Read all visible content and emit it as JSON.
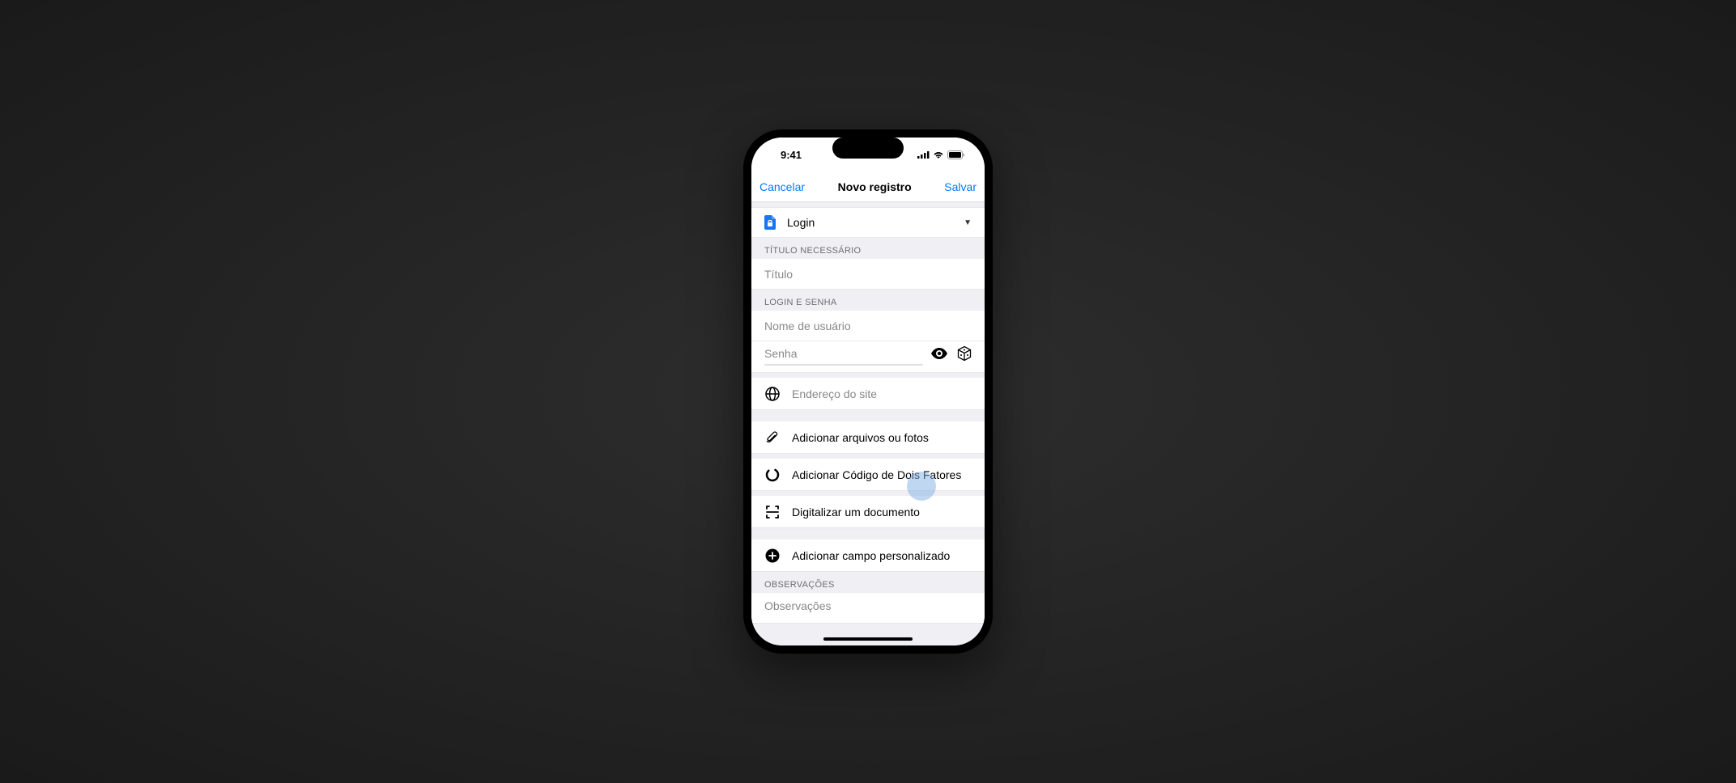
{
  "status_bar": {
    "time": "9:41"
  },
  "nav": {
    "cancel": "Cancelar",
    "title": "Novo registro",
    "save": "Salvar"
  },
  "type_selector": {
    "value": "Login"
  },
  "sections": {
    "title_header": "TÍTULO NECESSÁRIO",
    "login_header": "LOGIN E SENHA",
    "notes_header": "OBSERVAÇÕES"
  },
  "fields": {
    "title_placeholder": "Título",
    "username_placeholder": "Nome de usuário",
    "password_placeholder": "Senha",
    "website_placeholder": "Endereço do site",
    "notes_placeholder": "Observações"
  },
  "actions": {
    "add_files": "Adicionar arquivos ou fotos",
    "add_2fa": "Adicionar Código de Dois Fatores",
    "scan_document": "Digitalizar um documento",
    "add_custom_field": "Adicionar campo personalizado"
  }
}
